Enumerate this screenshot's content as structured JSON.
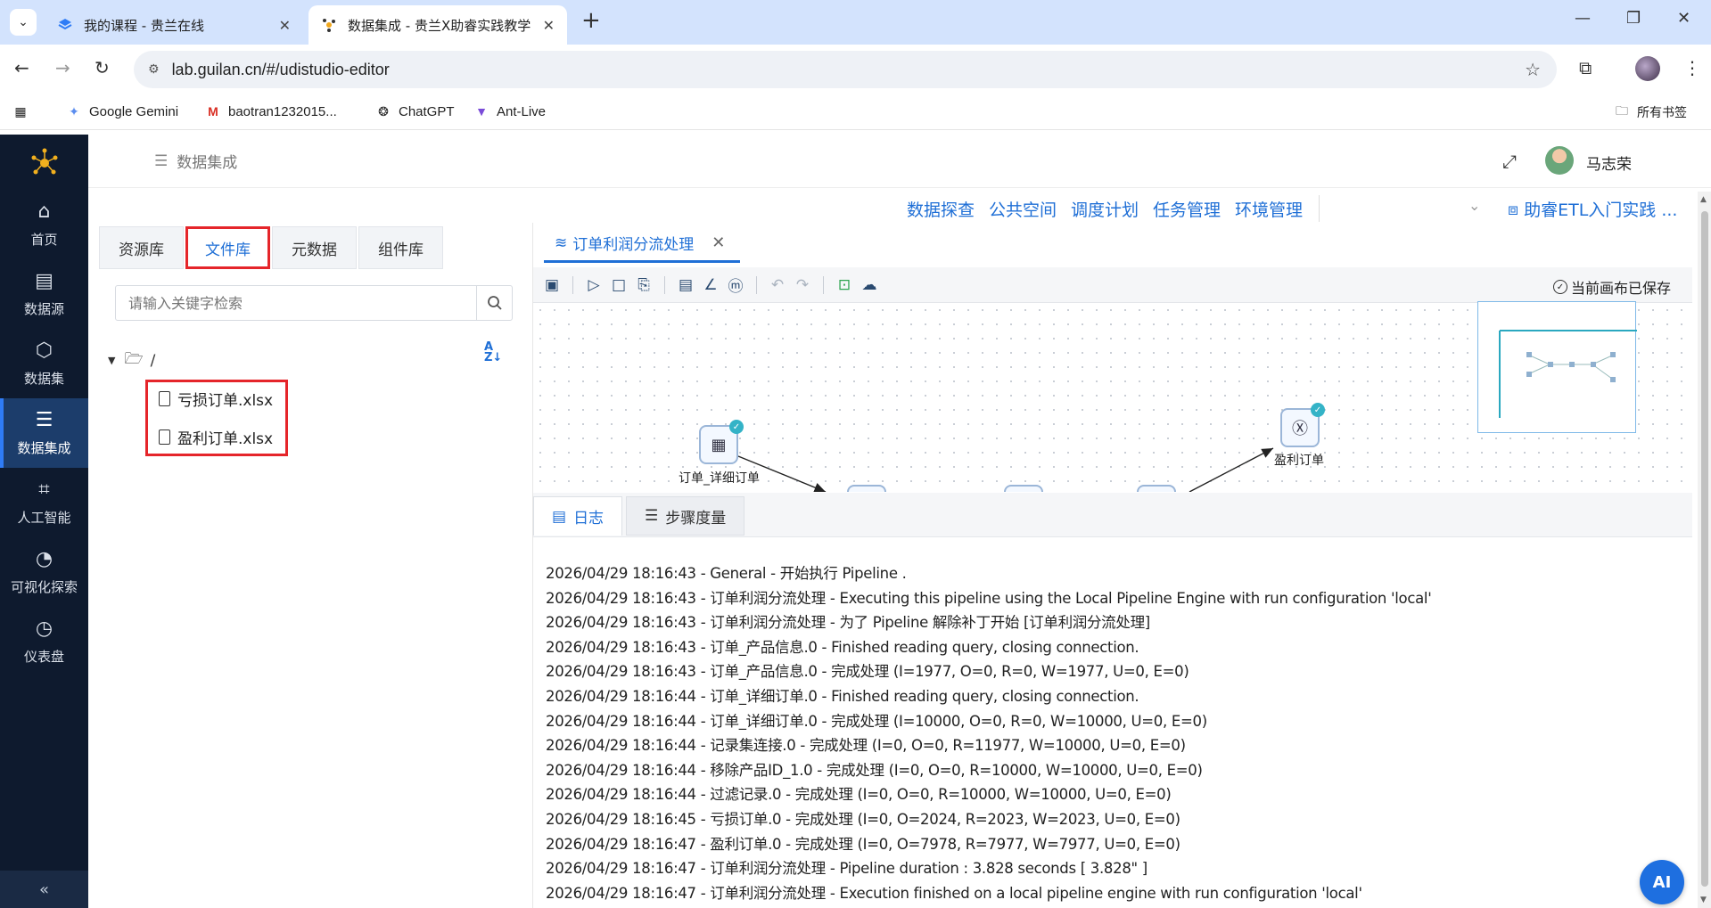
{
  "browser": {
    "tabs": [
      {
        "title": "我的课程 - 贵兰在线",
        "active": false
      },
      {
        "title": "数据集成 - 贵兰X助睿实践教学",
        "active": true
      }
    ],
    "url": "lab.guilan.cn/#/udistudio-editor",
    "bookmarks": [
      "Google Gemini",
      "baotran1232015...",
      "ChatGPT",
      "Ant-Live"
    ],
    "all_bookmarks": "所有书签"
  },
  "sidebar": {
    "items": [
      {
        "label": "首页",
        "icon": "home-icon"
      },
      {
        "label": "数据源",
        "icon": "database-icon"
      },
      {
        "label": "数据集",
        "icon": "cube-icon"
      },
      {
        "label": "数据集成",
        "icon": "integration-icon",
        "active": true
      },
      {
        "label": "人工智能",
        "icon": "ai-icon"
      },
      {
        "label": "可视化探索",
        "icon": "chart-icon"
      },
      {
        "label": "仪表盘",
        "icon": "dashboard-icon"
      }
    ],
    "collapse": "«"
  },
  "header": {
    "breadcrumb": "数据集成",
    "user": "马志荣"
  },
  "toplinks": [
    "数据探查",
    "公共空间",
    "调度计划",
    "任务管理",
    "环境管理"
  ],
  "project": "助睿ETL入门实践 ...",
  "left_panel": {
    "tabs": [
      "资源库",
      "文件库",
      "元数据",
      "组件库"
    ],
    "active_tab": "文件库",
    "search_placeholder": "请输入关键字检索",
    "root": "/",
    "files": [
      "亏损订单.xlsx",
      "盈利订单.xlsx"
    ]
  },
  "editor": {
    "tab_title": "订单利润分流处理",
    "saved_status": "当前画布已保存",
    "nodes": [
      {
        "label": "订单_详细订单"
      },
      {
        "label": "盈利订单"
      }
    ]
  },
  "log": {
    "tabs": [
      "日志",
      "步骤度量"
    ],
    "lines": [
      "2026/04/29 18:16:43 - General - 开始执行 Pipeline .",
      "2026/04/29 18:16:43 - 订单利润分流处理 - Executing this pipeline using the Local Pipeline Engine with run configuration 'local'",
      "2026/04/29 18:16:43 - 订单利润分流处理 - 为了 Pipeline 解除补丁开始 [订单利润分流处理]",
      "2026/04/29 18:16:43 - 订单_产品信息.0 - Finished reading query, closing connection.",
      "2026/04/29 18:16:43 - 订单_产品信息.0 - 完成处理 (I=1977, O=0, R=0, W=1977, U=0, E=0)",
      "2026/04/29 18:16:44 - 订单_详细订单.0 - Finished reading query, closing connection.",
      "2026/04/29 18:16:44 - 订单_详细订单.0 - 完成处理 (I=10000, O=0, R=0, W=10000, U=0, E=0)",
      "2026/04/29 18:16:44 - 记录集连接.0 - 完成处理 (I=0, O=0, R=11977, W=10000, U=0, E=0)",
      "2026/04/29 18:16:44 - 移除产品ID_1.0 - 完成处理 (I=0, O=0, R=10000, W=10000, U=0, E=0)",
      "2026/04/29 18:16:44 - 过滤记录.0 - 完成处理 (I=0, O=0, R=10000, W=10000, U=0, E=0)",
      "2026/04/29 18:16:45 - 亏损订单.0 - 完成处理 (I=0, O=2024, R=2023, W=2023, U=0, E=0)",
      "2026/04/29 18:16:47 - 盈利订单.0 - 完成处理 (I=0, O=7978, R=7977, W=7977, U=0, E=0)",
      "2026/04/29 18:16:47 - 订单利润分流处理 - Pipeline duration : 3.828 seconds [  3.828\" ]",
      "2026/04/29 18:16:47 - 订单利润分流处理 - Execution finished on a local pipeline engine with run configuration 'local'"
    ]
  },
  "ai_button": "AI",
  "colors": {
    "accent": "#1f6fd6",
    "sidebar_bg": "#0e1a2e",
    "highlight": "#e5252a"
  }
}
